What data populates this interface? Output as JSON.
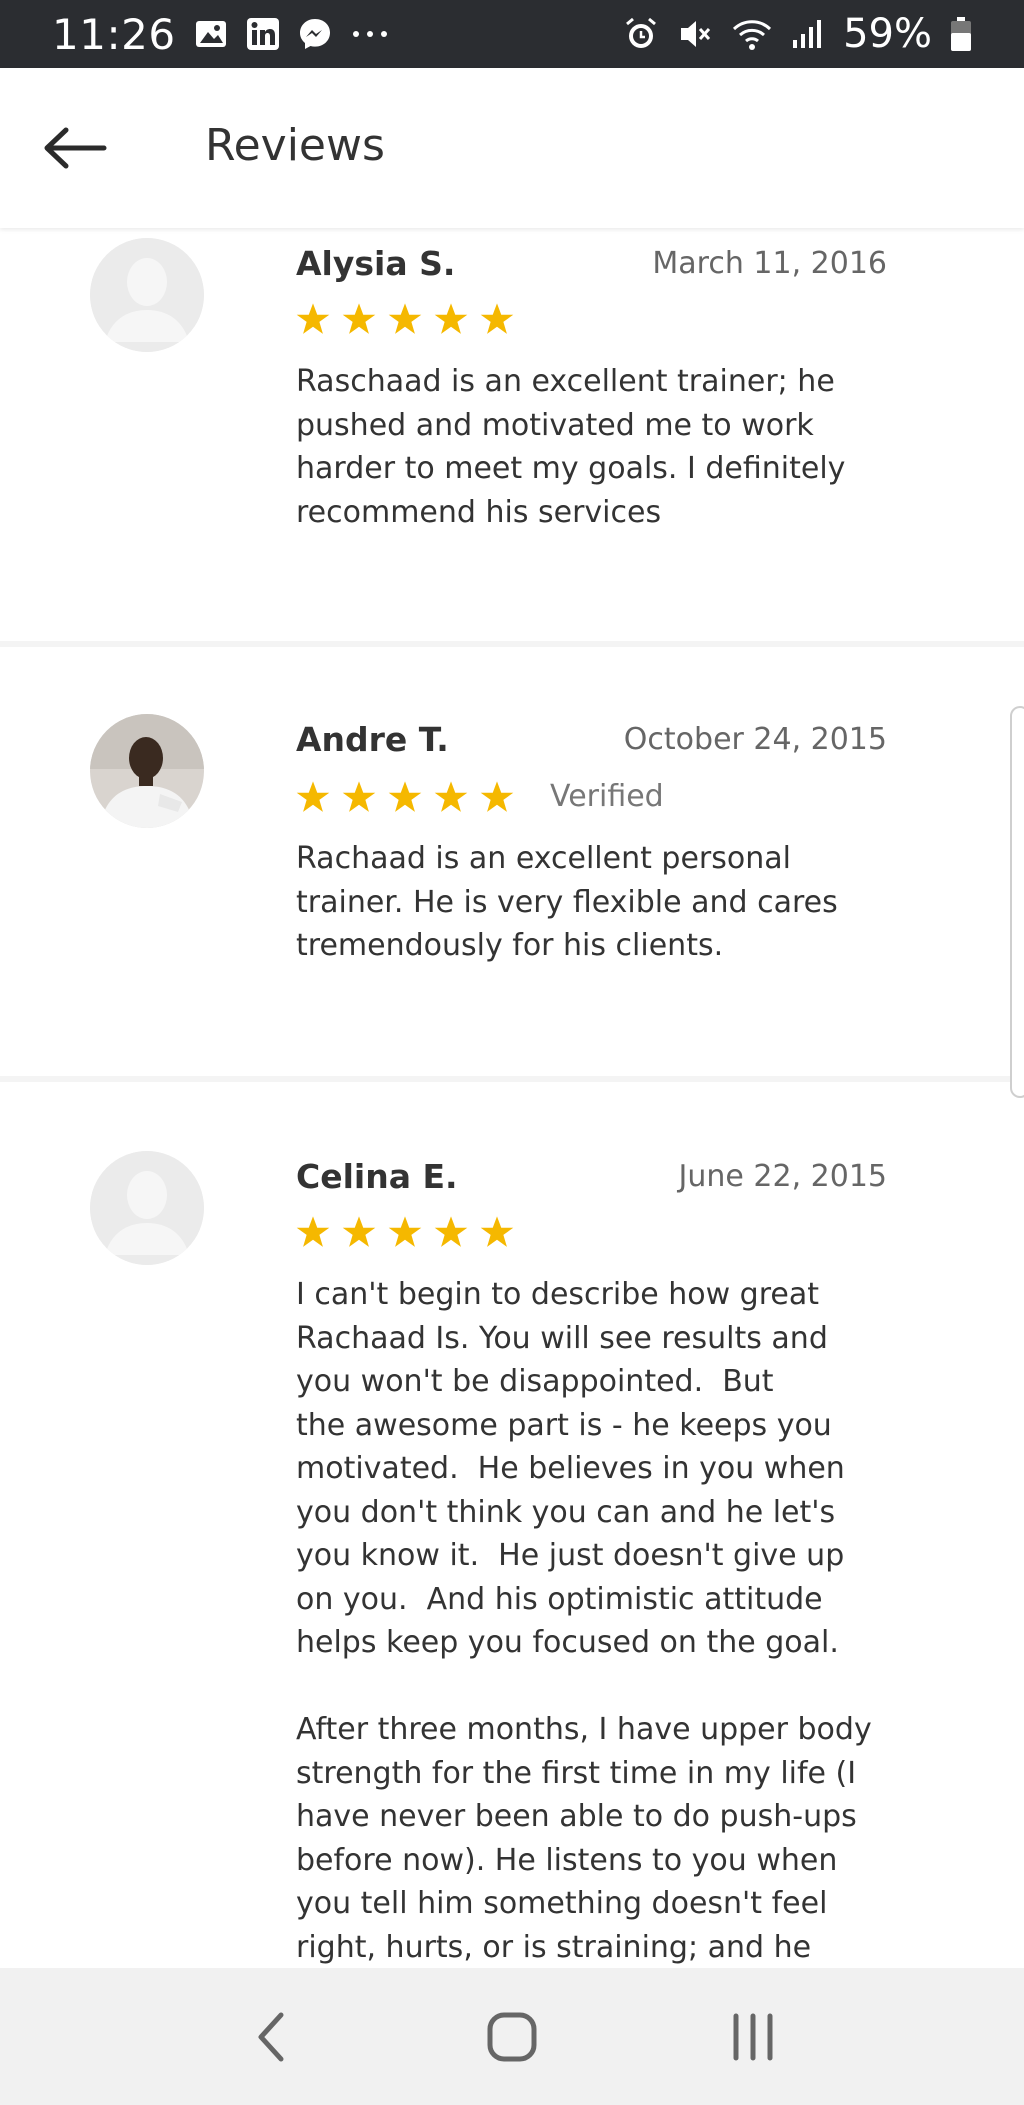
{
  "status_bar": {
    "time": "11:26",
    "battery_percent": "59%",
    "icons": [
      "gallery-icon",
      "linkedin-icon",
      "messenger-icon",
      "more-icon",
      "alarm-icon",
      "mute-icon",
      "wifi-icon",
      "signal-icon",
      "battery-icon"
    ]
  },
  "app_bar": {
    "title": "Reviews",
    "back_icon": "arrow-left-icon"
  },
  "colors": {
    "star": "#F5B800",
    "status_bar_bg": "#2B2D31",
    "nav_bar_bg": "#F1F1F1"
  },
  "reviews": [
    {
      "name": "Alysia S.",
      "date": "March 11, 2016",
      "rating": 5,
      "verified": "",
      "avatar": "placeholder",
      "text": "Raschaad is an excellent trainer; he\npushed and motivated me to work\nharder to meet my goals. I definitely\nrecommend his services"
    },
    {
      "name": "Andre T.",
      "date": "October 24, 2015",
      "rating": 5,
      "verified": "Verified",
      "avatar": "photo",
      "text": "Rachaad is an excellent personal\ntrainer. He is very flexible and cares\ntremendously for his clients."
    },
    {
      "name": "Celina E.",
      "date": "June 22, 2015",
      "rating": 5,
      "verified": "",
      "avatar": "placeholder",
      "text": "I can't begin to describe how great\nRachaad Is. You will see results and\nyou won't be disappointed.  But\nthe awesome part is - he keeps you\nmotivated.  He believes in you when\nyou don't think you can and he let's\nyou know it.  He just doesn't give up\non you.  And his optimistic attitude\nhelps keep you focused on the goal.\n\nAfter three months, I have upper body\nstrength for the first time in my life (I\nhave never been able to do push-ups\nbefore now). He listens to you when\nyou tell him something doesn't feel\nright, hurts, or is straining; and he"
    }
  ],
  "nav_bar": {
    "buttons": [
      "back-nav-icon",
      "home-nav-icon",
      "recents-nav-icon"
    ]
  }
}
